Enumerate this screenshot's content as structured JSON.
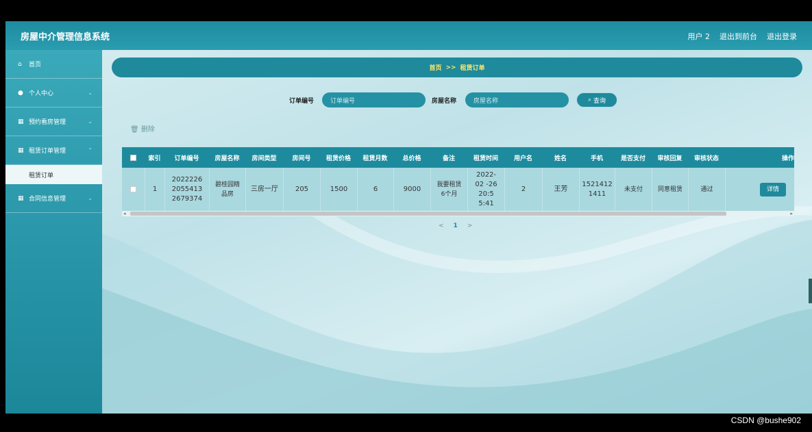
{
  "header": {
    "title": "房屋中介管理信息系统",
    "user": "用户 2",
    "to_front": "退出到前台",
    "logout": "退出登录"
  },
  "sidebar": {
    "items": [
      {
        "icon": "home-icon",
        "label": "首页"
      },
      {
        "icon": "user-icon",
        "label": "个人中心"
      },
      {
        "icon": "grid-icon",
        "label": "预约看房管理"
      },
      {
        "icon": "grid-icon",
        "label": "租赁订单管理"
      },
      {
        "icon": "grid-icon",
        "label": "合同信息管理"
      }
    ],
    "sub_item": "租赁订单"
  },
  "breadcrumb": {
    "home": "首页",
    "sep": ">>",
    "current": "租赁订单"
  },
  "search": {
    "order_label": "订单编号",
    "order_placeholder": "订单编号",
    "house_label": "房屋名称",
    "house_placeholder": "房屋名称",
    "button": "查询"
  },
  "toolbar": {
    "delete": "删除"
  },
  "table": {
    "headers": [
      "索引",
      "订单编号",
      "房屋名称",
      "房间类型",
      "房间号",
      "租赁价格",
      "租赁月数",
      "总价格",
      "备注",
      "租赁时间",
      "用户名",
      "姓名",
      "手机",
      "是否支付",
      "审核回复",
      "审核状态",
      "操作"
    ],
    "row": {
      "index": "1",
      "order_no": "2022226 2055413 2679374",
      "house_name": "碧桂园精品房",
      "room_type": "三房一厅",
      "room_no": "205",
      "price": "1500",
      "months": "6",
      "total": "9000",
      "remark": "我要租赁6个月",
      "rent_time": "2022-02 -26 20:5 5:41",
      "username": "2",
      "name": "王芳",
      "phone": "1521412 1411",
      "paid": "未支付",
      "review_reply": "同意租赁",
      "review_status": "通过",
      "action": "详情"
    }
  },
  "pager": {
    "prev": "<",
    "current": "1",
    "next": ">"
  },
  "watermark": "CSDN @bushe902"
}
